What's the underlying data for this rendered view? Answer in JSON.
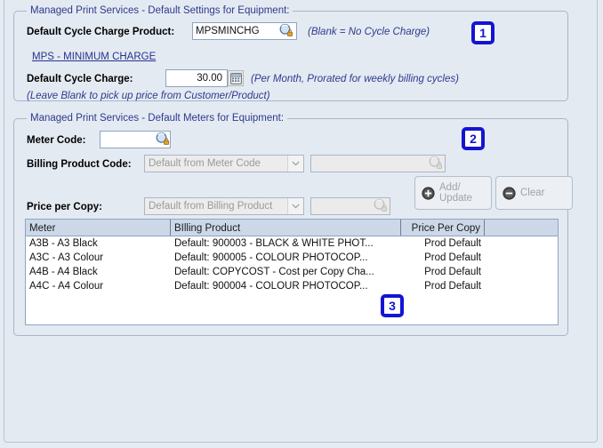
{
  "settings_panel": {
    "title": "Managed Print Services - Default Settings for Equipment:",
    "product_label": "Default Cycle Charge Product:",
    "product_value": "MPSMINCHG",
    "product_hint": "(Blank = No Cycle Charge)",
    "product_link": "MPS - MINIMUM CHARGE",
    "charge_label": "Default Cycle Charge:",
    "charge_value": "30.00",
    "charge_hint": "(Per Month, Prorated for weekly billing cycles)",
    "blank_hint": "(Leave Blank to pick up price from Customer/Product)",
    "search_icon": "search-icon",
    "calculator_icon": "calculator-icon",
    "badge": "1"
  },
  "meters_panel": {
    "title": "Managed Print Services - Default Meters for Equipment:",
    "meter_code_label": "Meter Code:",
    "meter_code_value": "",
    "billing_product_label": "Billing Product Code:",
    "billing_product_placeholder": "Default from Meter Code",
    "billing_product_desc_value": "",
    "price_per_copy_label": "Price per Copy:",
    "price_per_copy_placeholder": "Default from Billing Product",
    "price_per_copy_extra_value": "",
    "add_update_label": "Add/ Update",
    "clear_label": "Clear",
    "add_icon": "plus-circle-icon",
    "clear_icon": "minus-circle-icon",
    "search_icon": "search-icon",
    "badge": "2"
  },
  "grid": {
    "columns": [
      "Meter",
      "BIlling Product",
      "Price Per Copy",
      ""
    ],
    "rows": [
      [
        "A3B - A3 Black",
        "Default: 900003 - BLACK & WHITE PHOT...",
        "Prod Default",
        ""
      ],
      [
        "A3C - A3 Colour",
        "Default: 900005 - COLOUR PHOTOCOP...",
        "Prod Default",
        ""
      ],
      [
        "A4B - A4 Black",
        "Default: COPYCOST - Cost per Copy Cha...",
        "Prod Default",
        ""
      ],
      [
        "A4C - A4 Colour",
        "Default: 900004 - COLOUR PHOTOCOP...",
        "Prod Default",
        ""
      ]
    ],
    "badge": "3"
  },
  "colors": {
    "background": "#e4eaf2",
    "group_border": "#a8b6c9",
    "title_text": "#2e3a8c",
    "badge": "#1414d2",
    "header_bg": "#ccd8e8"
  }
}
